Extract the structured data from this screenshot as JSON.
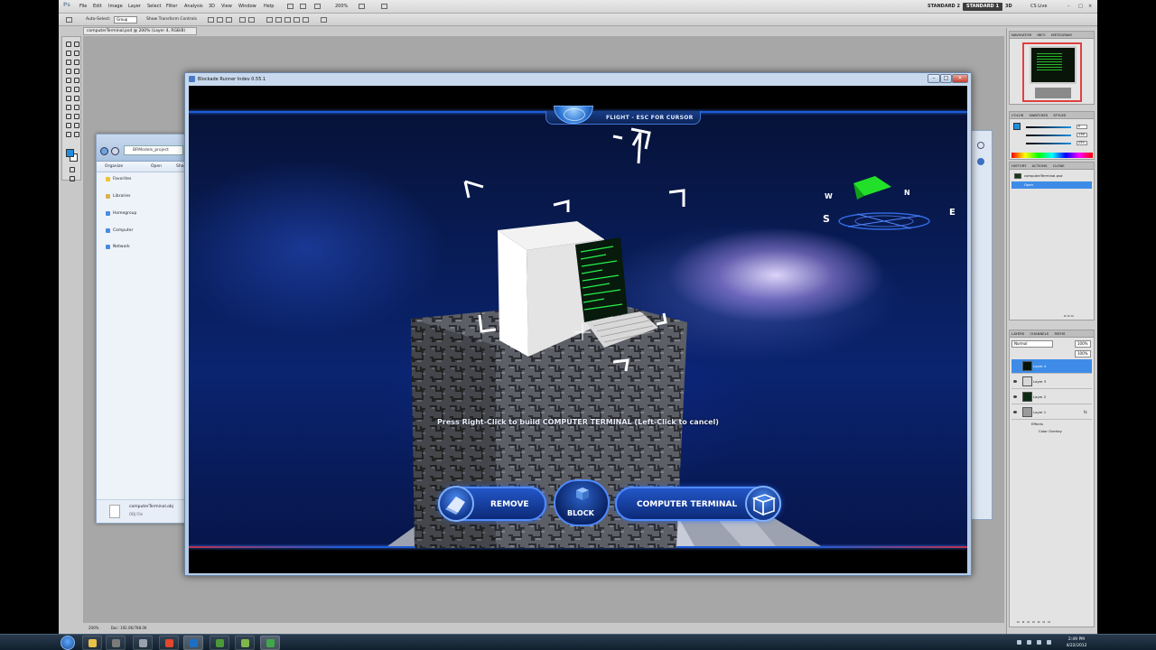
{
  "photoshop": {
    "menu": [
      "File",
      "Edit",
      "Image",
      "Layer",
      "Select",
      "Filter",
      "Analysis",
      "3D",
      "View",
      "Window",
      "Help"
    ],
    "zoom": "200%",
    "workspaces": [
      "STANDARD 2",
      "STANDARD 1"
    ],
    "active_workspace": "STANDARD 1",
    "cs_live": "CS Live",
    "options": {
      "auto_select": "Auto-Select:",
      "group_value": "Group",
      "show_transform": "Show Transform Controls"
    },
    "doc_tab": "computerTerminal.psd @ 200% (Layer 4, RGB/8)",
    "status_zoom": "200%",
    "status_doc": "Doc: 192.0K/788.0K",
    "panels": {
      "navigator_tabs": [
        "NAVIGATOR",
        "INFO",
        "HISTOGRAM"
      ],
      "color_tabs": [
        "COLOR",
        "SWATCHES",
        "STYLES"
      ],
      "color_values": [
        "0",
        "136",
        "255"
      ],
      "history_tabs": [
        "HISTORY",
        "ACTIONS",
        "CLONE"
      ],
      "history_items": [
        "computerTerminal.psd",
        "Open"
      ],
      "layers_tabs": [
        "LAYERS",
        "CHANNELS",
        "PATHS"
      ],
      "blend_mode": "Normal",
      "opacity": "100%",
      "fill": "100%",
      "layers": [
        "Layer 4",
        "Layer 3",
        "Layer 2",
        "Layer 1"
      ],
      "effects_label": "Effects",
      "effect_item": "Color Overlay"
    }
  },
  "explorer": {
    "address": "BRModels_project",
    "commands": [
      "Organize",
      "Open",
      "Share"
    ],
    "nav": [
      "Favorites",
      "Libraries",
      "Homegroup",
      "Computer",
      "Network"
    ],
    "selected_file": "computerTerminal.obj",
    "file_type": "OBJ File"
  },
  "game": {
    "window_title": "Blockade Runner Indev 0.55.1",
    "hud_mode": "FLIGHT  -  ESC FOR CURSOR",
    "compass": {
      "w": "W",
      "n": "N",
      "s": "S",
      "e": "E"
    },
    "prompt": "Press Right-Click to build COMPUTER TERMINAL (Left-Click to cancel)",
    "buttons": {
      "remove": "REMOVE",
      "block": "BLOCK",
      "computer_terminal": "COMPUTER TERMINAL"
    }
  },
  "taskbar": {
    "time": "2:49 PM",
    "date": "4/22/2012"
  },
  "colors": {
    "accent_blue": "#1e5bd8",
    "terminal_screen": "#1fe03a",
    "ps_selection": "#3e8ce8"
  }
}
